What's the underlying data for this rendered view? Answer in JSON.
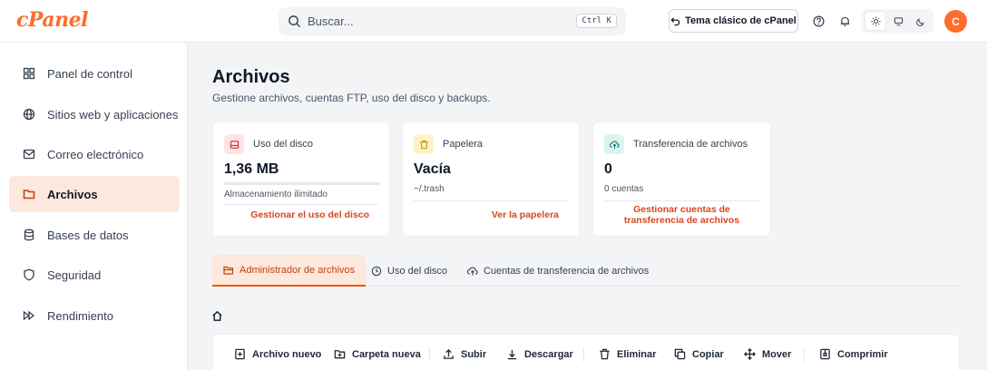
{
  "brand": {
    "logo_text": "cPanel",
    "accent": "#ff6c2c",
    "link_color": "#d6461e"
  },
  "header": {
    "search_placeholder": "Buscar...",
    "shortcut": "Ctrl K",
    "classic_theme_label": "Tema clásico de cPanel",
    "avatar_initial": "C"
  },
  "sidebar": {
    "items": [
      {
        "label": "Panel de control",
        "icon": "dashboard-icon"
      },
      {
        "label": "Sitios web y aplicaciones",
        "icon": "globe-icon"
      },
      {
        "label": "Correo electrónico",
        "icon": "mail-icon"
      },
      {
        "label": "Archivos",
        "icon": "folder-icon",
        "active": true
      },
      {
        "label": "Bases de datos",
        "icon": "database-icon"
      },
      {
        "label": "Seguridad",
        "icon": "shield-icon"
      },
      {
        "label": "Rendimiento",
        "icon": "fast-forward-icon"
      }
    ]
  },
  "main": {
    "title": "Archivos",
    "subtitle": "Gestione archivos, cuentas FTP, uso del disco y backups.",
    "cards": [
      {
        "title": "Uso del disco",
        "value": "1,36 MB",
        "note": "Almacenamiento ilimitado",
        "link": "Gestionar el uso del disco",
        "icon": "hard-drive-icon",
        "chip_bg": "#fde4e4",
        "chip_fg": "#dc2626"
      },
      {
        "title": "Papelera",
        "value": "Vacía",
        "note": "~/.trash",
        "link": "Ver la papelera",
        "icon": "trash-icon",
        "chip_bg": "#fdf3c7",
        "chip_fg": "#ca8a04"
      },
      {
        "title": "Transferencia de archivos",
        "value": "0",
        "note": "0 cuentas",
        "link_line1": "Gestionar cuentas de",
        "link_line2": "transferencia de archivos",
        "icon": "cloud-upload-icon",
        "chip_bg": "#d9f5ee",
        "chip_fg": "#0f766e"
      }
    ],
    "tabs": [
      {
        "label": "Administrador de archivos",
        "active": true
      },
      {
        "label": "Uso del disco"
      },
      {
        "label": "Cuentas de transferencia de archivos"
      }
    ],
    "toolbar": {
      "new_file": "Archivo nuevo",
      "new_folder": "Carpeta nueva",
      "upload": "Subir",
      "download": "Descargar",
      "delete": "Eliminar",
      "copy": "Copiar",
      "move": "Mover",
      "compress": "Comprimir"
    }
  }
}
